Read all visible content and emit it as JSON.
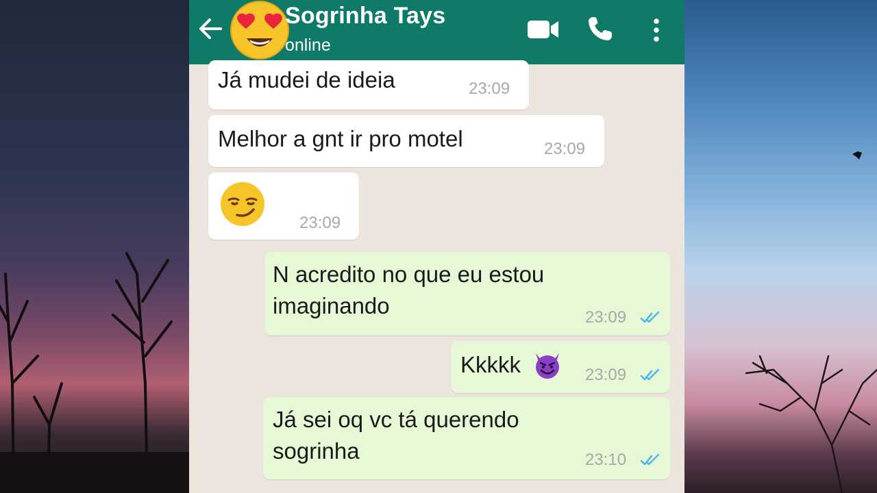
{
  "header": {
    "contact_name": "Sogrinha Tays",
    "status": "online",
    "icons": [
      "back-arrow-icon",
      "heart-eyes-emoji-avatar",
      "video-call-icon",
      "phone-call-icon",
      "more-options-icon"
    ]
  },
  "messages": [
    {
      "direction": "in",
      "text": "Já mudei de ideia",
      "time": "23:09"
    },
    {
      "direction": "in",
      "text": "Melhor a gnt ir pro motel",
      "time": "23:09"
    },
    {
      "direction": "in",
      "text": "",
      "emoji": "smirking-face-emoji",
      "time": "23:09"
    },
    {
      "direction": "out",
      "line1": "N acredito no que eu estou",
      "line2": "imaginando",
      "time": "23:09",
      "status": "read"
    },
    {
      "direction": "out",
      "text": "Kkkkk",
      "emoji": "smiling-imp-emoji",
      "time": "23:09",
      "status": "read"
    },
    {
      "direction": "out",
      "line1": "Já sei oq vc tá querendo",
      "line2": "sogrinha",
      "time": "23:10",
      "status": "read"
    }
  ],
  "colors": {
    "header": "#0f7a68",
    "chat_background": "#ece5dd",
    "incoming_bubble": "#ffffff",
    "outgoing_bubble": "#e6f8d6",
    "read_tick": "#4fb6ec"
  }
}
